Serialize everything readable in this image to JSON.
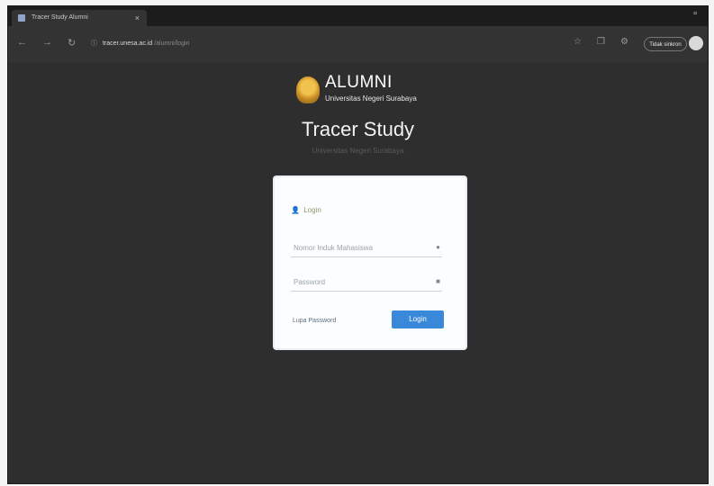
{
  "browser": {
    "tab_title": "Tracer Study Alumni",
    "tab_close": "×",
    "window_control": "▫",
    "address": {
      "lock_icon": "ⓘ",
      "host": "tracer.unesa.ac.id",
      "path": "/alumni/login"
    },
    "profile_label": "Tidak sinkron",
    "icons": [
      "back-icon",
      "forward-icon",
      "refresh-icon",
      "star-icon",
      "settings-icon"
    ]
  },
  "page": {
    "brand_name": "ALUMNI",
    "brand_sub": "Universitas Negeri Surabaya",
    "title": "Tracer Study",
    "subtitle": "Universitas Negeri Surabaya"
  },
  "login": {
    "heading": "Login",
    "username_placeholder": "Nomor Induk Mahasiswa",
    "password_placeholder": "Password",
    "forgot_label": "Lupa Password",
    "submit_label": "Login"
  }
}
